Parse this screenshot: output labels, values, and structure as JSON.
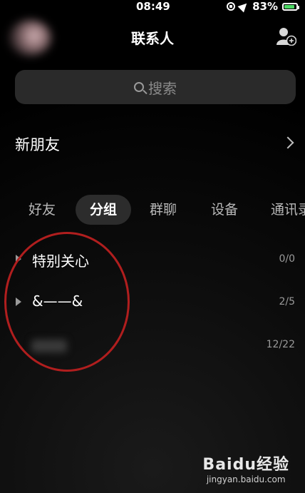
{
  "status_bar": {
    "time": "08:49",
    "battery": "83%"
  },
  "header": {
    "title": "联系人"
  },
  "search": {
    "placeholder": "搜索"
  },
  "new_friends": {
    "label": "新朋友"
  },
  "tabs": [
    {
      "label": "好友",
      "active": false
    },
    {
      "label": "分组",
      "active": true
    },
    {
      "label": "群聊",
      "active": false
    },
    {
      "label": "设备",
      "active": false
    },
    {
      "label": "通讯录",
      "active": false
    }
  ],
  "groups": [
    {
      "name": "特别关心",
      "count": "0/0"
    },
    {
      "name": "&——&",
      "count": "2/5"
    },
    {
      "name": "",
      "count": "12/22"
    }
  ],
  "watermark": {
    "logo": "Baidu经验",
    "url": "jingyan.baidu.com"
  },
  "colors": {
    "annotation": "#b01e1e",
    "battery_fill": "#4cd964",
    "search_bg": "#2a2a2a"
  }
}
